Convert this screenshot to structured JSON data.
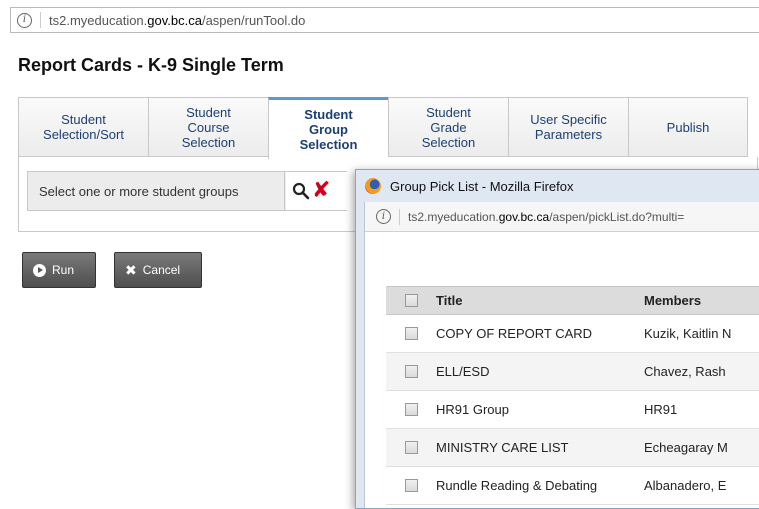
{
  "browser": {
    "url_prefix": "ts2.myeducation.",
    "url_domain": "gov.bc.ca",
    "url_suffix": "/aspen/runTool.do"
  },
  "page": {
    "title": "Report Cards - K-9 Single Term"
  },
  "tabs": [
    {
      "label": "Student\nSelection/Sort",
      "active": false
    },
    {
      "label": "Student\nCourse\nSelection",
      "active": false
    },
    {
      "label": "Student\nGroup\nSelection",
      "active": true
    },
    {
      "label": "Student\nGrade\nSelection",
      "active": false
    },
    {
      "label": "User Specific\nParameters",
      "active": false
    },
    {
      "label": "Publish",
      "active": false
    }
  ],
  "selection": {
    "label": "Select one or more student groups",
    "search_icon": "magnify-icon",
    "clear_icon": "x-icon",
    "clear_glyph": "✘"
  },
  "buttons": {
    "run_label": "Run",
    "cancel_label": "Cancel",
    "cancel_glyph": "✖"
  },
  "popup": {
    "window_title": "Group Pick List - Mozilla Firefox",
    "url_prefix": "ts2.myeducation.",
    "url_domain": "gov.bc.ca",
    "url_suffix": "/aspen/pickList.do?multi=",
    "columns": {
      "title": "Title",
      "members": "Members"
    },
    "rows": [
      {
        "title": "COPY OF REPORT CARD",
        "members": "Kuzik, Kaitlin N"
      },
      {
        "title": "ELL/ESD",
        "members": "Chavez, Rash"
      },
      {
        "title": "HR91 Group",
        "members": "HR91"
      },
      {
        "title": "MINISTRY CARE LIST",
        "members": "Echeagaray M"
      },
      {
        "title": "Rundle Reading & Debating",
        "members": "Albanadero, E"
      }
    ]
  },
  "colors": {
    "accent": "#5b9bd5",
    "tab_text": "#1c3f73",
    "clear_red": "#d0021b",
    "button_dark": "#555555"
  }
}
